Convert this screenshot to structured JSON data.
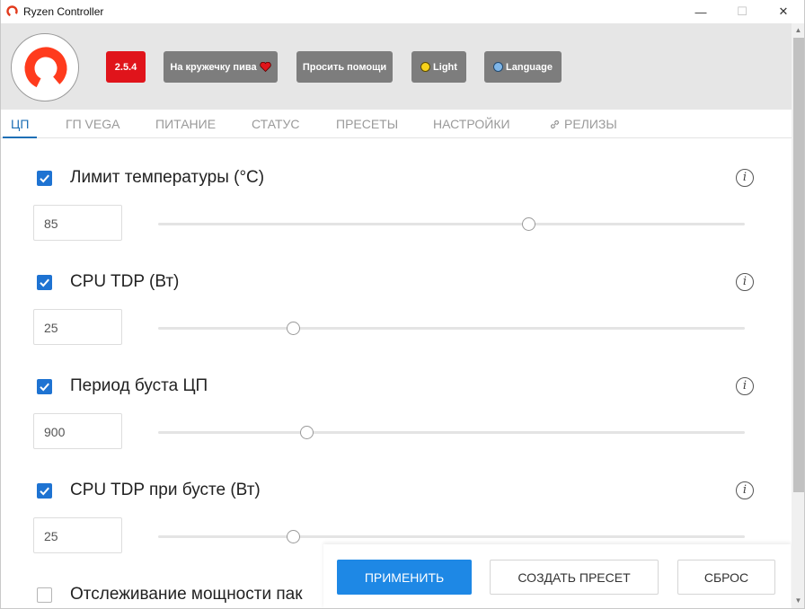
{
  "window": {
    "title": "Ryzen Controller",
    "minimize": "—",
    "maximize": "☐",
    "close": "✕"
  },
  "header": {
    "version": "2.5.4",
    "beer_label": "На кружечку пива",
    "help_label": "Просить помощи",
    "light_label": "Light",
    "language_label": "Language"
  },
  "tabs": [
    {
      "label": "ЦП",
      "active": true
    },
    {
      "label": "ГП VEGA"
    },
    {
      "label": "ПИТАНИЕ"
    },
    {
      "label": "СТАТУС"
    },
    {
      "label": "ПРЕСЕТЫ"
    },
    {
      "label": "НАСТРОЙКИ"
    },
    {
      "label": "РЕЛИЗЫ"
    }
  ],
  "settings": [
    {
      "label": "Лимит температуры (°C)",
      "enabled": true,
      "value": "85",
      "slider_fraction": 0.632
    },
    {
      "label": "CPU TDP (Вт)",
      "enabled": true,
      "value": "25",
      "slider_fraction": 0.231
    },
    {
      "label": "Период буста ЦП",
      "enabled": true,
      "value": "900",
      "slider_fraction": 0.254
    },
    {
      "label": "CPU TDP при бусте (Вт)",
      "enabled": true,
      "value": "25",
      "slider_fraction": 0.231
    },
    {
      "label": "Отслеживание мощности пак",
      "enabled": false
    }
  ],
  "info_glyph": "i",
  "actions": {
    "apply": "ПРИМЕНИТЬ",
    "create_preset": "СОЗДАТЬ ПРЕСЕТ",
    "reset": "СБРОС"
  },
  "colors": {
    "accent_blue": "#1e88e5",
    "tab_active": "#1e6fb5",
    "version_red": "#e0141b",
    "logo_red": "#ff3b1d"
  }
}
